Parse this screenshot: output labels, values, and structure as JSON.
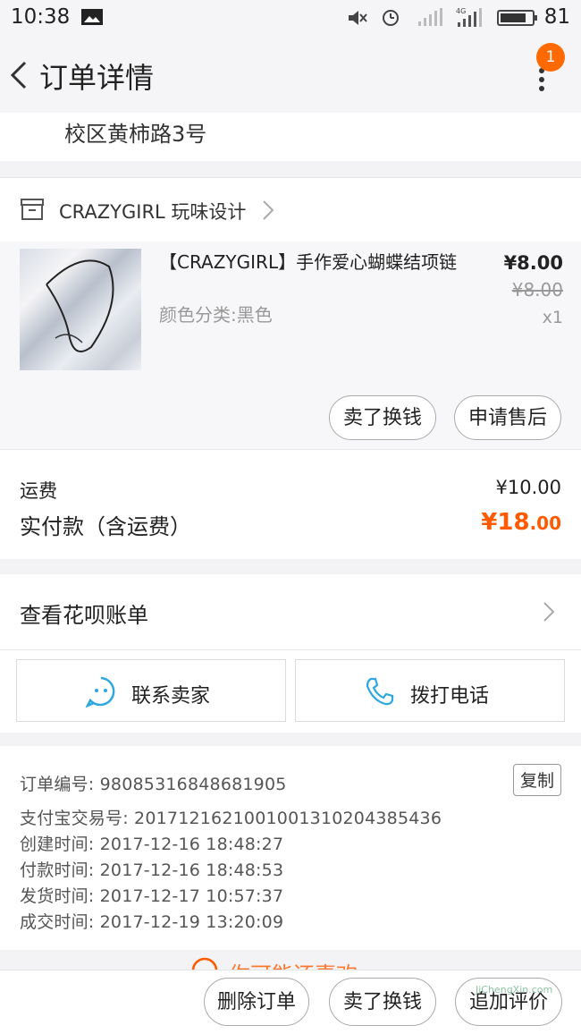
{
  "status_bar": {
    "time": "10:38",
    "battery": "81"
  },
  "header": {
    "title": "订单详情",
    "badge_count": "1"
  },
  "address": {
    "line": "校区黄柿路3号"
  },
  "shop": {
    "name": "CRAZYGIRL 玩味设计"
  },
  "item": {
    "title": "【CRAZYGIRL】手作爱心蝴蝶结项链",
    "sku": "颜色分类:黑色",
    "price_now": "¥8.00",
    "price_old": "¥8.00",
    "quantity": "x1",
    "sell_button": "卖了换钱",
    "after_sale_button": "申请售后"
  },
  "fees": {
    "shipping_label": "运费",
    "shipping_value": "¥10.00",
    "paid_label": "实付款（含运费）",
    "paid_symbol": "¥",
    "paid_integer": "18",
    "paid_decimal": ".00"
  },
  "huabei": {
    "label": "查看花呗账单"
  },
  "contact": {
    "seller_label": "联系卖家",
    "phone_label": "拨打电话"
  },
  "order_info": {
    "order_no": "订单编号: 98085316848681905",
    "copy_label": "复制",
    "alipay_no": "支付宝交易号: 2017121621001001310204385436",
    "created": "创建时间: 2017-12-16 18:48:27",
    "paid": "付款时间: 2017-12-16 18:48:53",
    "shipped": "发货时间: 2017-12-17 10:57:37",
    "completed": "成交时间: 2017-12-19 13:20:09"
  },
  "promo": {
    "text": "你可能还喜欢"
  },
  "bottom_bar": {
    "delete_label": "删除订单",
    "sell_label": "卖了换钱",
    "review_label": "追加评价"
  },
  "watermark": {
    "text": "JiChengXin.com"
  },
  "colors": {
    "accent": "#ff5a00",
    "badge": "#ff6a00",
    "icon_blue": "#2ea7e0"
  }
}
